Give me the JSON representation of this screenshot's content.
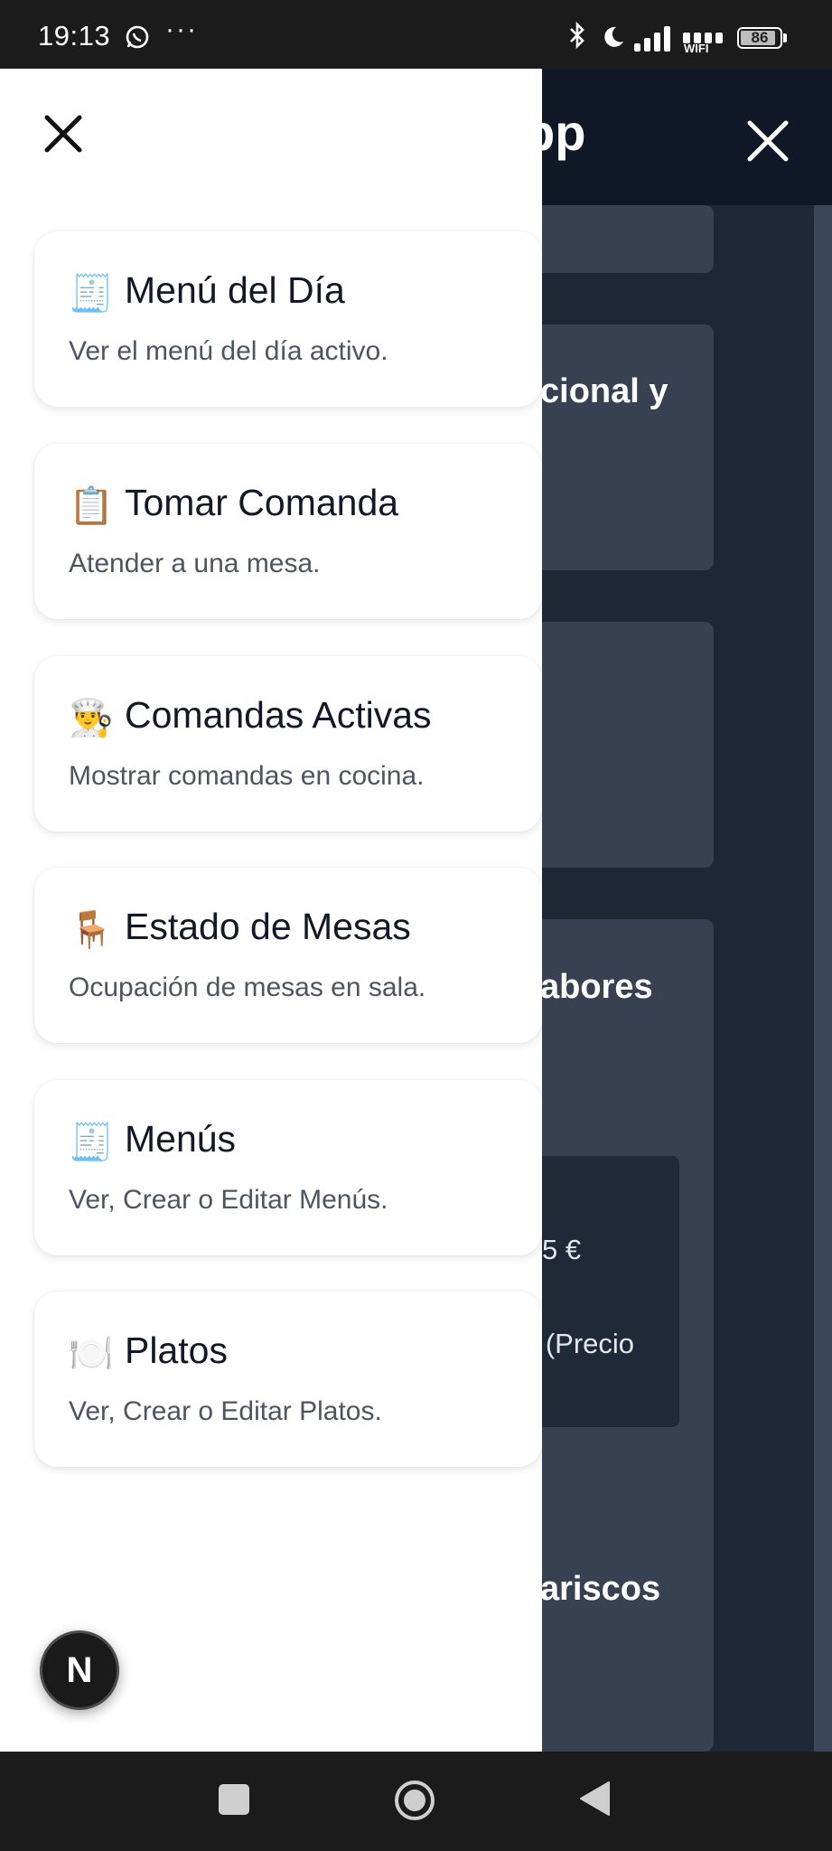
{
  "status_bar": {
    "time": "19:13",
    "overflow": "···",
    "wifi_label": "WIFI",
    "battery": "86"
  },
  "background_app": {
    "header_title": "pp",
    "fragments": [
      "cional y",
      "abores",
      "5 €",
      "€ (Precio",
      "ariscos"
    ]
  },
  "drawer": {
    "items": [
      {
        "icon": "🧾",
        "title": "Menú del Día",
        "description": "Ver el menú del día activo."
      },
      {
        "icon": "📋",
        "title": "Tomar Comanda",
        "description": "Atender a una mesa."
      },
      {
        "icon": "👨‍🍳",
        "title": "Comandas Activas",
        "description": "Mostrar comandas en cocina."
      },
      {
        "icon": "🪑",
        "title": "Estado de Mesas",
        "description": "Ocupación de mesas en sala."
      },
      {
        "icon": "🧾",
        "title": "Menús",
        "description": "Ver, Crear o Editar Menús."
      },
      {
        "icon": "🍽️",
        "title": "Platos",
        "description": "Ver, Crear o Editar Platos."
      }
    ],
    "badge_letter": "N"
  }
}
